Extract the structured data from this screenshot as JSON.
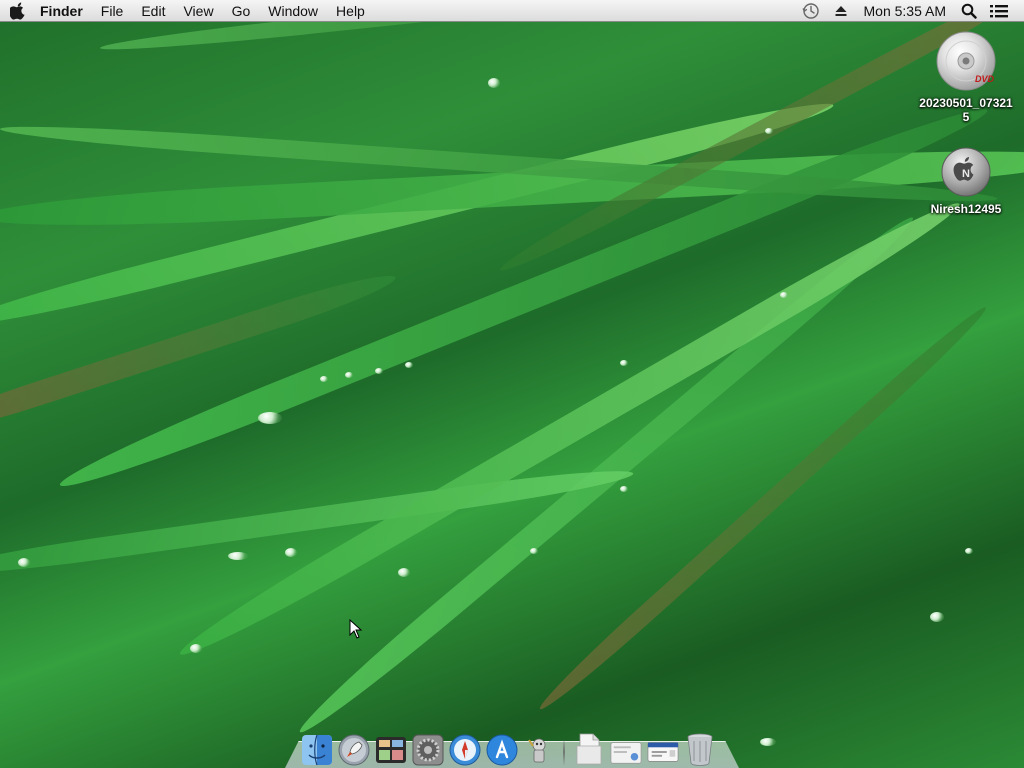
{
  "menubar": {
    "apple_icon": "apple-logo-icon",
    "app_name": "Finder",
    "menus": [
      "File",
      "Edit",
      "View",
      "Go",
      "Window",
      "Help"
    ],
    "status": {
      "time_machine_icon": "time-machine-icon",
      "eject_icon": "eject-icon",
      "clock": "Mon 5:35 AM",
      "spotlight_icon": "spotlight-search-icon",
      "notification_icon": "notification-list-icon"
    }
  },
  "desktop_icons": [
    {
      "label": "20230501_073215",
      "icon": "dvd-disc-icon"
    },
    {
      "label": "Niresh12495",
      "icon": "hard-disk-icon"
    }
  ],
  "dock": {
    "items": [
      {
        "name": "finder",
        "icon": "finder-icon"
      },
      {
        "name": "launchpad",
        "icon": "launchpad-rocket-icon"
      },
      {
        "name": "mission-control",
        "icon": "mission-control-icon"
      },
      {
        "name": "system-preferences",
        "icon": "system-preferences-gear-icon"
      },
      {
        "name": "safari",
        "icon": "safari-compass-icon"
      },
      {
        "name": "app-store",
        "icon": "app-store-icon"
      },
      {
        "name": "automator",
        "icon": "automator-robot-icon"
      }
    ],
    "right_items": [
      {
        "name": "documents",
        "icon": "documents-folder-icon"
      },
      {
        "name": "downloads",
        "icon": "downloads-stack-icon"
      },
      {
        "name": "mail-stack",
        "icon": "envelope-stack-icon"
      },
      {
        "name": "trash",
        "icon": "trash-icon"
      }
    ]
  },
  "colors": {
    "menubar_bg": "#e8e8e8",
    "wallpaper": "#2f8f39",
    "dock_indicator": "#2d7fd0"
  }
}
